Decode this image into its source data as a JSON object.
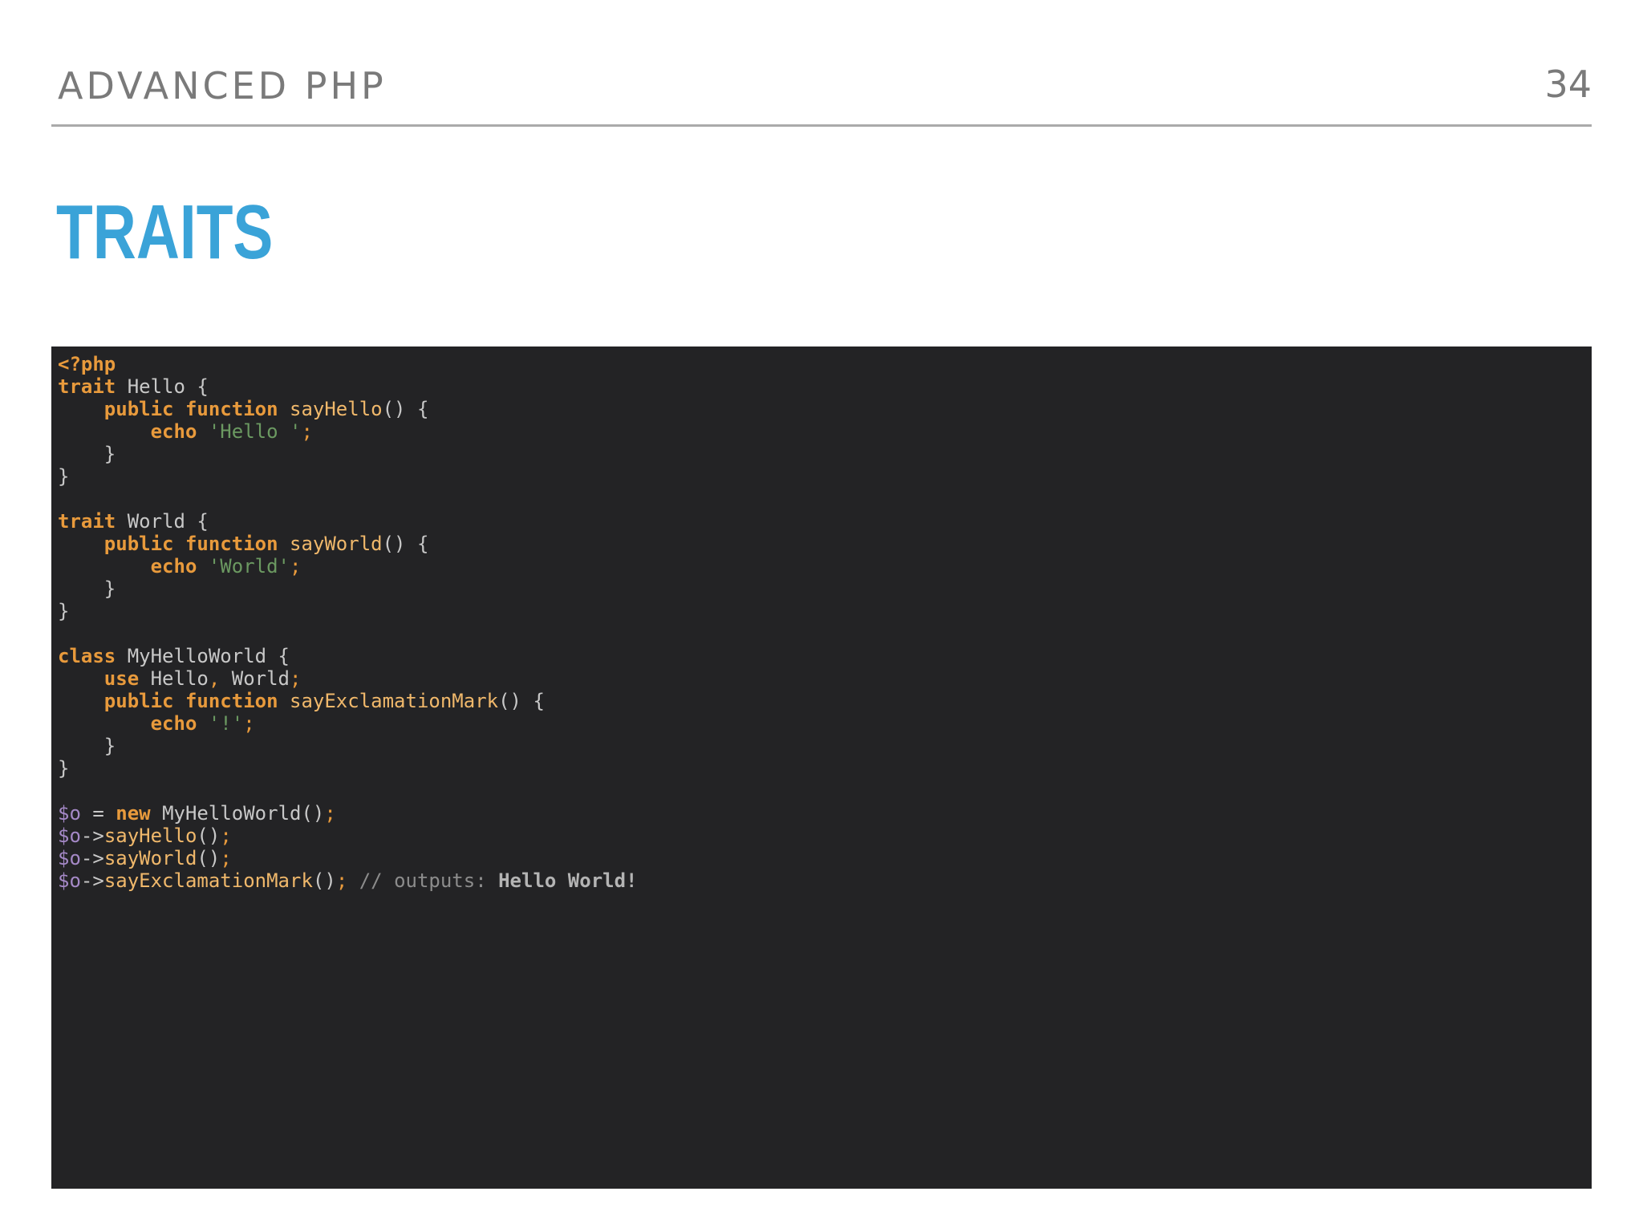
{
  "slide": {
    "header": "ADVANCED PHP",
    "page_number": "34",
    "title": "TRAITS"
  },
  "code": {
    "language": "php",
    "t1": "<?php",
    "t2": "trait",
    "t3": " Hello {",
    "t4": "    ",
    "t5": "public",
    "t6": " ",
    "t7": "function",
    "t8": " ",
    "t9": "sayHello",
    "t10": "() {",
    "t11": "        ",
    "t12": "echo",
    "t13": " ",
    "t14": "'Hello '",
    "t15": ";",
    "t16": "    }",
    "t17": "}",
    "t18": "trait",
    "t19": " World {",
    "t20": "    ",
    "t21": "public",
    "t22": " ",
    "t23": "function",
    "t24": " ",
    "t25": "sayWorld",
    "t26": "() {",
    "t27": "        ",
    "t28": "echo",
    "t29": " ",
    "t30": "'World'",
    "t31": ";",
    "t32": "    }",
    "t33": "}",
    "t34": "class",
    "t35": " MyHelloWorld {",
    "t36": "    ",
    "t37": "use",
    "t38": " Hello",
    "t39": ",",
    "t40": " World",
    "t41": ";",
    "t42": "    ",
    "t43": "public",
    "t44": " ",
    "t45": "function",
    "t46": " ",
    "t47": "sayExclamationMark",
    "t48": "() {",
    "t49": "        ",
    "t50": "echo",
    "t51": " ",
    "t52": "'!'",
    "t53": ";",
    "t54": "    }",
    "t55": "}",
    "t56": "$o",
    "t57": " = ",
    "t58": "new",
    "t59": " MyHelloWorld()",
    "t60": ";",
    "t61": "$o",
    "t62": "->",
    "t63": "sayHello",
    "t64": "()",
    "t65": ";",
    "t66": "$o",
    "t67": "->",
    "t68": "sayWorld",
    "t69": "()",
    "t70": ";",
    "t71": "$o",
    "t72": "->",
    "t73": "sayExclamationMark",
    "t74": "()",
    "t75": ";",
    "t76": " // outputs: ",
    "t77": "Hello World!"
  }
}
